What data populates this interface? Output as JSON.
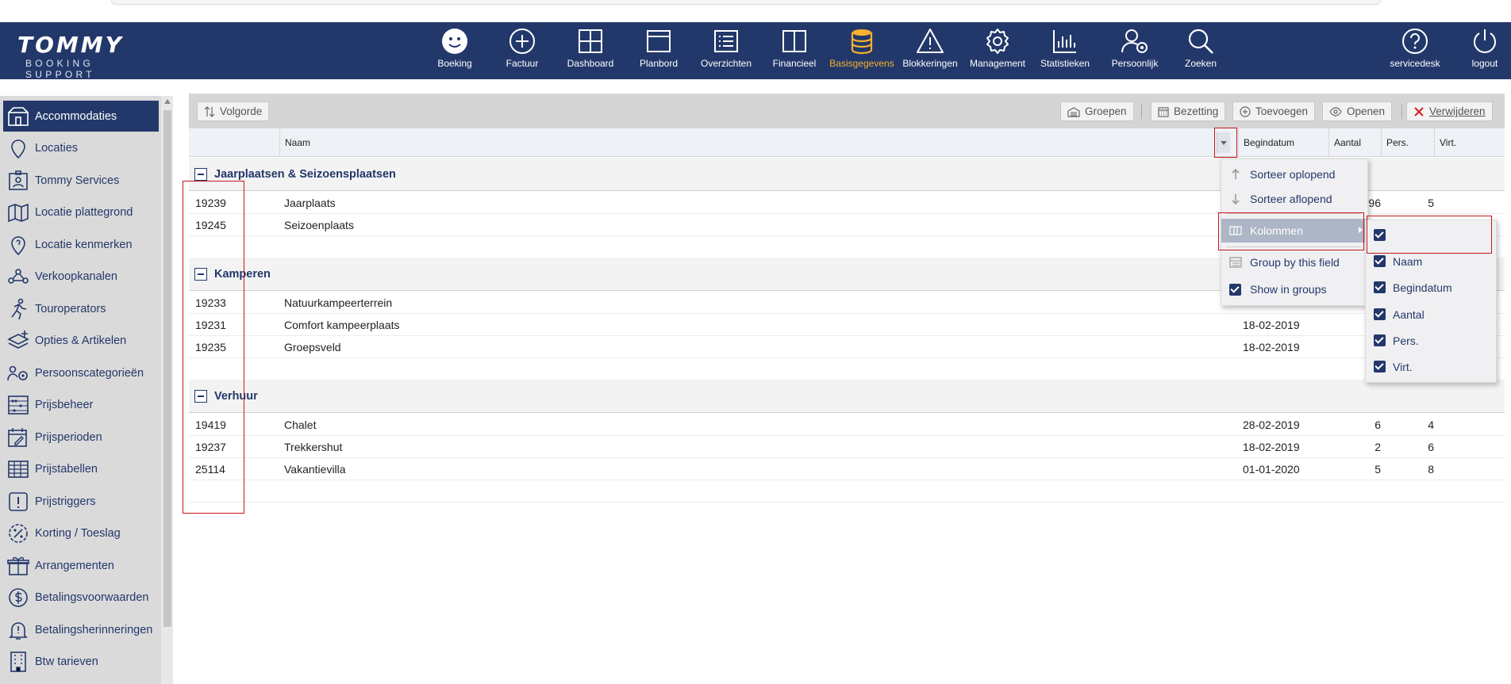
{
  "brand": {
    "name": "TOMMY",
    "subtitle": "BOOKING SUPPORT"
  },
  "nav": [
    {
      "label": "Boeking",
      "icon": "smiley-icon"
    },
    {
      "label": "Factuur",
      "icon": "plus-circle-icon"
    },
    {
      "label": "Dashboard",
      "icon": "grid-icon"
    },
    {
      "label": "Planbord",
      "icon": "window-icon"
    },
    {
      "label": "Overzichten",
      "icon": "list-icon"
    },
    {
      "label": "Financieel",
      "icon": "columns-icon"
    },
    {
      "label": "Basisgegevens",
      "icon": "database-icon",
      "active": true
    },
    {
      "label": "Blokkeringen",
      "icon": "warning-icon"
    },
    {
      "label": "Management",
      "icon": "gear-icon"
    },
    {
      "label": "Statistieken",
      "icon": "bar-chart-icon"
    },
    {
      "label": "Persoonlijk",
      "icon": "user-gear-icon"
    },
    {
      "label": "Zoeken",
      "icon": "search-icon"
    }
  ],
  "nav_right": [
    {
      "label": "servicedesk",
      "icon": "help-icon"
    },
    {
      "label": "logout",
      "icon": "power-icon"
    }
  ],
  "sidebar": {
    "items": [
      {
        "label": "Accommodaties",
        "icon": "accommodation-icon",
        "active": true
      },
      {
        "label": "Locaties",
        "icon": "location-pin-icon"
      },
      {
        "label": "Tommy Services",
        "icon": "badge-icon"
      },
      {
        "label": "Locatie plattegrond",
        "icon": "map-icon"
      },
      {
        "label": "Locatie kenmerken",
        "icon": "pin-question-icon"
      },
      {
        "label": "Verkoopkanalen",
        "icon": "network-icon"
      },
      {
        "label": "Touroperators",
        "icon": "runner-icon"
      },
      {
        "label": "Opties & Artikelen",
        "icon": "layers-plus-icon"
      },
      {
        "label": "Persoonscategorieën",
        "icon": "people-gear-icon"
      },
      {
        "label": "Prijsbeheer",
        "icon": "abacus-icon"
      },
      {
        "label": "Prijsperioden",
        "icon": "calendar-edit-icon"
      },
      {
        "label": "Prijstabellen",
        "icon": "table-icon"
      },
      {
        "label": "Prijstriggers",
        "icon": "exclamation-box-icon"
      },
      {
        "label": "Korting / Toeslag",
        "icon": "percent-badge-icon"
      },
      {
        "label": "Arrangementen",
        "icon": "gift-icon"
      },
      {
        "label": "Betalingsvoorwaarden",
        "icon": "dollar-circle-icon"
      },
      {
        "label": "Betalingsherinneringen",
        "icon": "bell-alert-icon"
      },
      {
        "label": "Btw tarieven",
        "icon": "building-icon"
      }
    ]
  },
  "toolbar": {
    "order_label": "Volgorde",
    "groups_label": "Groepen",
    "occupancy_label": "Bezetting",
    "add_label": "Toevoegen",
    "open_label": "Openen",
    "delete_label": "Verwijderen"
  },
  "grid": {
    "columns": [
      "Naam",
      "Begindatum",
      "Aantal",
      "Pers.",
      "Virt."
    ],
    "groups": [
      {
        "title": "Jaarplaatsen & Seizoensplaatsen",
        "rows": [
          {
            "id": "19239",
            "naam": "Jaarplaats",
            "begindatum": "",
            "aantal": "96",
            "pers": "5"
          },
          {
            "id": "19245",
            "naam": "Seizoenplaats",
            "begindatum": "",
            "aantal": "",
            "pers": ""
          }
        ]
      },
      {
        "title": "Kamperen",
        "rows": [
          {
            "id": "19233",
            "naam": "Natuurkampeerterrein",
            "begindatum": "",
            "aantal": "",
            "pers": ""
          },
          {
            "id": "19231",
            "naam": "Comfort kampeerplaats",
            "begindatum": "18-02-2019",
            "aantal": "",
            "pers": ""
          },
          {
            "id": "19235",
            "naam": "Groepsveld",
            "begindatum": "18-02-2019",
            "aantal": "",
            "pers": ""
          }
        ]
      },
      {
        "title": "Verhuur",
        "rows": [
          {
            "id": "19419",
            "naam": "Chalet",
            "begindatum": "28-02-2019",
            "aantal": "6",
            "pers": "4"
          },
          {
            "id": "19237",
            "naam": "Trekkershut",
            "begindatum": "18-02-2019",
            "aantal": "2",
            "pers": "6"
          },
          {
            "id": "25114",
            "naam": "Vakantievilla",
            "begindatum": "01-01-2020",
            "aantal": "5",
            "pers": "8"
          }
        ]
      }
    ]
  },
  "context_menu": {
    "sort_asc": "Sorteer oplopend",
    "sort_desc": "Sorteer aflopend",
    "columns": "Kolommen",
    "group_by": "Group by this field",
    "show_in_groups": "Show in groups"
  },
  "columns_submenu": {
    "items": [
      "",
      "Naam",
      "Begindatum",
      "Aantal",
      "Pers.",
      "Virt."
    ]
  },
  "colors": {
    "navy": "#23386a",
    "accent": "#f6b22f",
    "annotation": "#c8161d"
  }
}
